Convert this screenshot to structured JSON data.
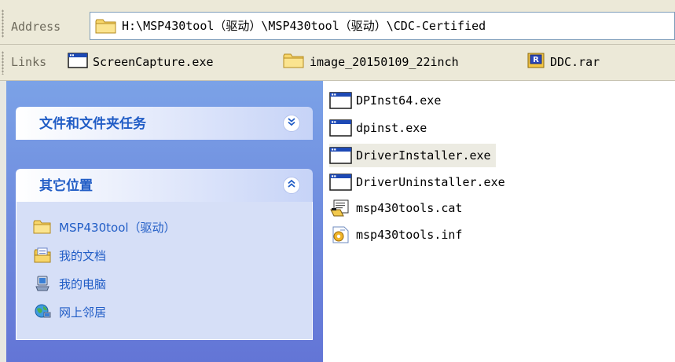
{
  "address_bar": {
    "label": "Address",
    "path": "H:\\MSP430tool（驱动）\\MSP430tool（驱动）\\CDC-Certified"
  },
  "links_bar": {
    "label": "Links",
    "items": [
      {
        "label": "ScreenCapture.exe",
        "icon": "window-exe-icon"
      },
      {
        "label": "image_20150109_22inch",
        "icon": "folder-icon"
      },
      {
        "label": "DDC.rar",
        "icon": "rar-archive-icon"
      }
    ]
  },
  "task_pane": {
    "file_tasks": {
      "title": "文件和文件夹任务",
      "state": "collapsed",
      "button_icon": "expand-chevrons-icon"
    },
    "other_places": {
      "title": "其它位置",
      "state": "expanded",
      "button_icon": "collapse-chevrons-icon",
      "items": [
        {
          "label": "MSP430tool（驱动）",
          "icon": "folder-icon"
        },
        {
          "label": "我的文档",
          "icon": "my-documents-icon"
        },
        {
          "label": "我的电脑",
          "icon": "my-computer-icon"
        },
        {
          "label": "网上邻居",
          "icon": "network-places-icon"
        }
      ]
    }
  },
  "files": [
    {
      "name": "DPInst64.exe",
      "icon": "window-exe-icon",
      "selected": false
    },
    {
      "name": "dpinst.exe",
      "icon": "window-exe-icon",
      "selected": false
    },
    {
      "name": "DriverInstaller.exe",
      "icon": "window-exe-icon",
      "selected": true
    },
    {
      "name": "DriverUninstaller.exe",
      "icon": "window-exe-icon",
      "selected": false
    },
    {
      "name": "msp430tools.cat",
      "icon": "security-catalog-icon",
      "selected": false
    },
    {
      "name": "msp430tools.inf",
      "icon": "setup-info-icon",
      "selected": false
    }
  ],
  "colors": {
    "toolbar_bg": "#ece9d8",
    "taskpane_gradient_top": "#7ba2e7",
    "taskpane_gradient_bottom": "#6375d6",
    "panel_title": "#215dc6",
    "panel_body": "#d6dff7",
    "selection_bg": "#ecebe2"
  }
}
